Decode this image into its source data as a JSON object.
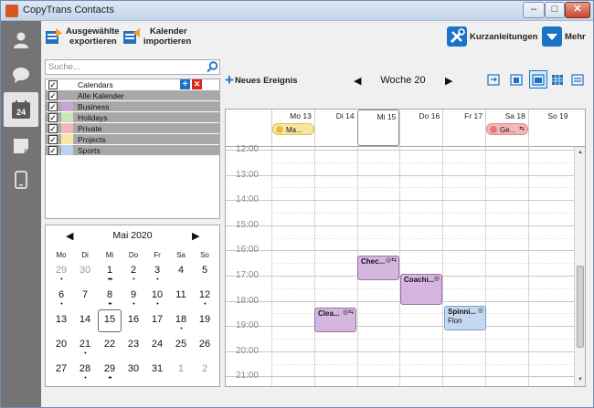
{
  "window": {
    "title": "CopyTrans Contacts",
    "minimize": "–",
    "maximize": "□",
    "close": "✕"
  },
  "toolbar": {
    "export_line1": "Ausgewählte",
    "export_line2": "exportieren",
    "import_line1": "Kalender",
    "import_line2": "importieren",
    "guides": "Kurzanleitungen",
    "more": "Mehr"
  },
  "search": {
    "placeholder": "Suche..."
  },
  "calendars": {
    "header": "Calendars",
    "items": [
      {
        "label": "Alle Kalender",
        "color": "#a8a8a8"
      },
      {
        "label": "Business",
        "color": "#c7a6d6"
      },
      {
        "label": "Holidays",
        "color": "#c9e6b4"
      },
      {
        "label": "Private",
        "color": "#f4b7b7"
      },
      {
        "label": "Projects",
        "color": "#f7e6a4"
      },
      {
        "label": "Sports",
        "color": "#b9d3ef"
      }
    ]
  },
  "mini_calendar": {
    "month": "Mai 2020",
    "weekdays": [
      "Mo",
      "Di",
      "Mi",
      "Do",
      "Fr",
      "Sa",
      "So"
    ],
    "weeks": [
      [
        "29",
        "30",
        "1",
        "2",
        "3",
        "4",
        "5"
      ],
      [
        "6",
        "7",
        "8",
        "9",
        "10",
        "11",
        "12"
      ],
      [
        "13",
        "14",
        "15",
        "16",
        "17",
        "18",
        "19"
      ],
      [
        "20",
        "21",
        "22",
        "23",
        "24",
        "25",
        "26"
      ],
      [
        "27",
        "28",
        "29",
        "30",
        "31",
        "1",
        "2"
      ]
    ],
    "today": "15",
    "other_month_color": "#9a9a9a"
  },
  "week_nav": {
    "new_event": "Neues Ereignis",
    "week": "Woche 20"
  },
  "week_view": {
    "days": [
      "Mo 13",
      "Di 14",
      "Mi 15",
      "Do 16",
      "Fr 17",
      "Sa 18",
      "So 19"
    ],
    "hours": [
      "12:00",
      "13:00",
      "14:00",
      "15:00",
      "16:00",
      "17:00",
      "18:00",
      "19:00",
      "20:00",
      "21:00"
    ],
    "allday_events": [
      {
        "title": "Ma...",
        "color": "#f7e6a4"
      },
      {
        "title": "Ge...",
        "color": "#f4b7b7"
      }
    ],
    "events": [
      {
        "title": "Chec...",
        "color": "#d4b6df"
      },
      {
        "title": "Coachi...",
        "color": "#d4b6df"
      },
      {
        "title": "Clea...",
        "color": "#d4b6df"
      },
      {
        "title": "Spinni...",
        "subtitle": "Flon",
        "color": "#c4d9f0"
      }
    ]
  },
  "colors": {
    "accent": "#1a73c8",
    "sidebar": "#747474"
  }
}
